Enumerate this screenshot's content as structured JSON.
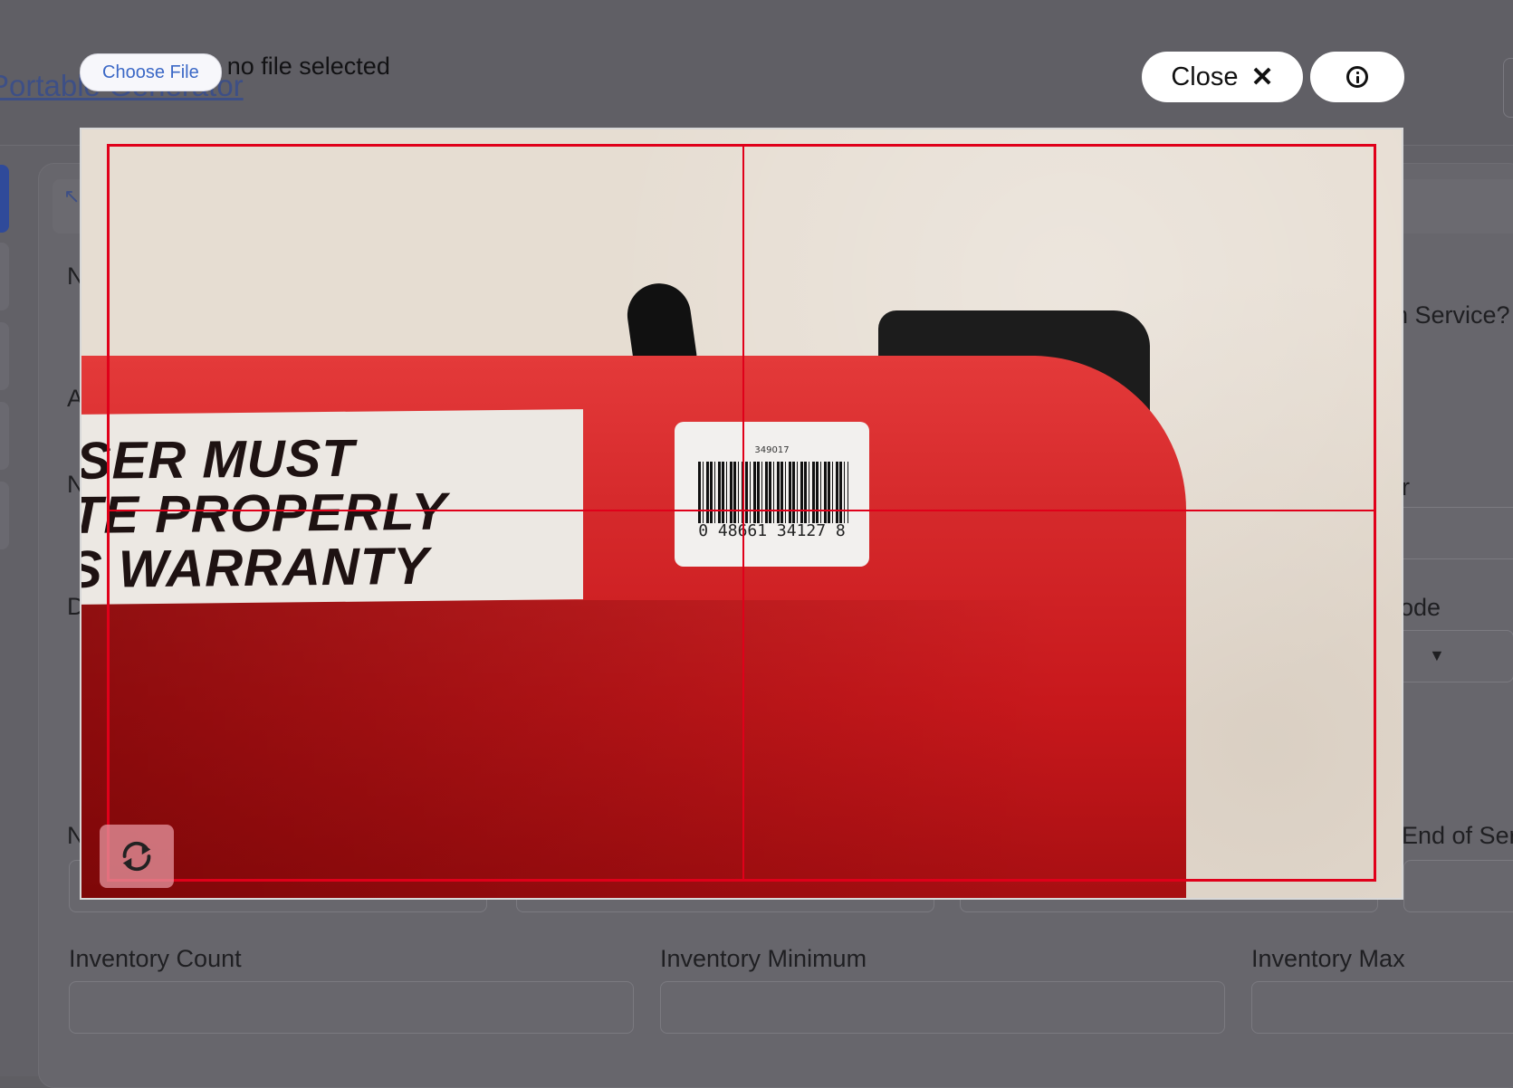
{
  "background": {
    "item_link": "Portable Generator",
    "labels": {
      "inventory_count": "Inventory Count",
      "inventory_minimum": "Inventory Minimum",
      "inventory_max": "Inventory Max",
      "partial_service": "n Service?",
      "partial_r": "r",
      "partial_code": "ode",
      "partial_end_of_service": "End of Ser"
    }
  },
  "file_input": {
    "button_label": "Choose File",
    "status": "no file selected"
  },
  "toolbar": {
    "close_label": "Close",
    "close_icon": "close-icon",
    "info_icon": "info-icon"
  },
  "camera": {
    "warning_lines": [
      "SER MUST",
      "TE PROPERLY",
      "S WARRANTY"
    ],
    "barcode_top": "349017",
    "barcode_number": "0 48661 34127 8",
    "scan_frame_color": "#e0001a",
    "switch_camera_icon": "camera-flip-icon"
  }
}
